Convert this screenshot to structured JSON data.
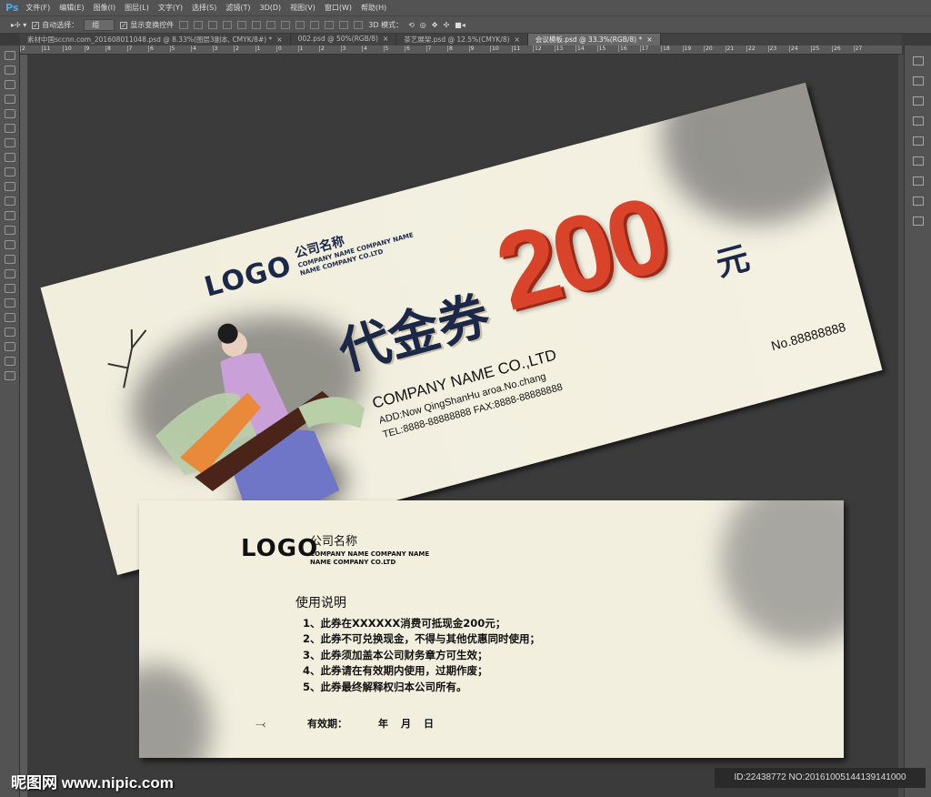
{
  "app": {
    "logo": "Ps"
  },
  "menu": [
    "文件(F)",
    "编辑(E)",
    "图像(I)",
    "图层(L)",
    "文字(Y)",
    "选择(S)",
    "滤镜(T)",
    "3D(D)",
    "视图(V)",
    "窗口(W)",
    "帮助(H)"
  ],
  "options": {
    "auto_select_label": "自动选择：",
    "auto_select_value": "组",
    "show_transform_label": "显示变换控件",
    "mode_3d_label": "3D 模式："
  },
  "tabs": [
    {
      "label": "素材中国sccnn.com_201608011048.psd @ 8.33%(图层3副本, CMYK/8#) *",
      "active": false
    },
    {
      "label": "002.psd @ 50%(RGB/8)",
      "active": false
    },
    {
      "label": "茶艺展架.psd @ 12.5%(CMYK/8)",
      "active": false
    },
    {
      "label": "会议模板.psd @ 33.3%(RGB/8) *",
      "active": true
    }
  ],
  "ruler_marks": [
    "2",
    "11",
    "10",
    "9",
    "8",
    "7",
    "6",
    "5",
    "4",
    "3",
    "2",
    "1",
    "0",
    "1",
    "2",
    "3",
    "4",
    "5",
    "6",
    "7",
    "8",
    "9",
    "10",
    "11",
    "12",
    "13",
    "14",
    "15",
    "16",
    "17",
    "18",
    "19",
    "20",
    "21",
    "22",
    "23",
    "24",
    "25",
    "26",
    "27"
  ],
  "front": {
    "logo": "LOGO",
    "company_cn": "公司名称",
    "company_en_1": "COMPANY NAME COMPANY NAME",
    "company_en_2": "NAME COMPANY CO.LTD",
    "title": "代金券",
    "amount": "200",
    "currency": "元",
    "company_name": "COMPANY NAME CO.,LTD",
    "address": "ADD:Now QingShanHu aroa.No.chang",
    "contact": "TEL:8888-88888888  FAX:8888-88888888",
    "serial": "No.88888888"
  },
  "back": {
    "logo": "LOGO",
    "company_cn": "公司名称",
    "company_en_1": "COMPANY NAME COMPANY NAME",
    "company_en_2": "NAME COMPANY CO.LTD",
    "rules_title": "使用说明",
    "rules": [
      "1、此券在XXXXXX消费可抵现金200元；",
      "2、此券不可兑换现金，不得与其他优惠同时使用；",
      "3、此券须加盖本公司财务章方可生效；",
      "4、此券请在有效期内使用，过期作废；",
      "5、此券最终解释权归本公司所有。"
    ],
    "validity_label": "有效期：",
    "year": "年",
    "month": "月",
    "day": "日"
  },
  "watermark": {
    "site": "昵图网 www.nipic.com",
    "id": "ID:22438772 NO:20161005144139141000"
  }
}
